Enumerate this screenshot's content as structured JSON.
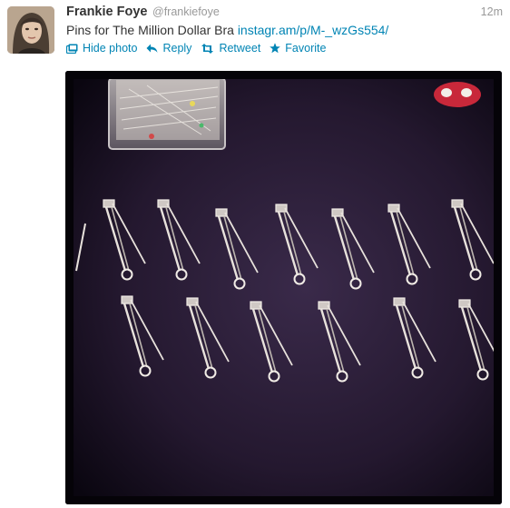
{
  "tweet": {
    "author_name": "Frankie Foye",
    "author_handle": "@frankiefoye",
    "timestamp": "12m",
    "text": "Pins for The Million Dollar Bra",
    "link": "instagr.am/p/M-_wzGs554/"
  },
  "actions": {
    "hide_photo": "Hide photo",
    "reply": "Reply",
    "retweet": "Retweet",
    "favorite": "Favorite"
  },
  "colors": {
    "link": "#0084b4",
    "muted": "#999999",
    "text": "#333333"
  }
}
